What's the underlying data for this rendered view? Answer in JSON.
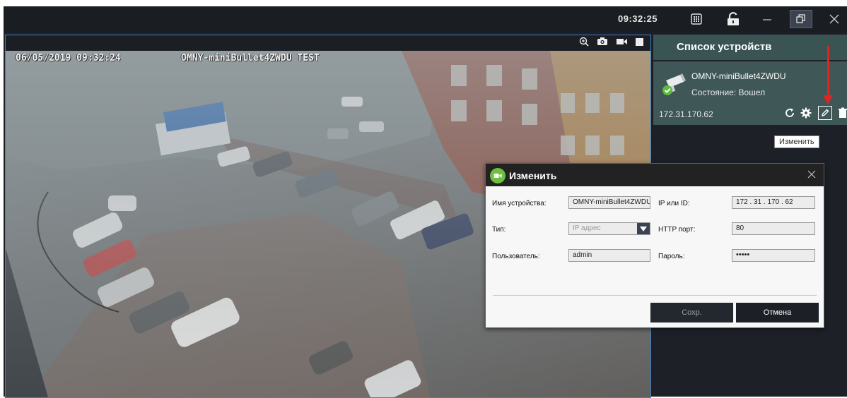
{
  "titlebar": {
    "time": "09:32:25",
    "icons": [
      "grid-icon",
      "lock-icon",
      "minimize-icon",
      "restore-icon",
      "close-icon"
    ]
  },
  "video": {
    "osd_datetime": "06/05/2019 09:32:24",
    "osd_camera_name": "OMNY-miniBullet4ZWDU TEST",
    "toolbar_icons": [
      "zoom-icon",
      "snapshot-icon",
      "record-icon",
      "stop-icon"
    ]
  },
  "sidebar": {
    "title": "Список устройств",
    "device": {
      "name": "OMNY-miniBullet4ZWDU",
      "status": "Состояние: Вошел",
      "ip": "172.31.170.62",
      "actions": [
        "refresh-icon",
        "settings-icon",
        "edit-icon",
        "delete-icon"
      ]
    },
    "tooltip": "Изменить"
  },
  "dialog": {
    "title": "Изменить",
    "fields": {
      "device_name_label": "Имя устройства:",
      "device_name_value": "OMNY-miniBullet4ZWDU",
      "ip_label": "IP или ID:",
      "ip_value": "172 . 31 . 170 . 62",
      "type_label": "Тип:",
      "type_value": "IP адрес",
      "http_port_label": "HTTP порт:",
      "http_port_value": "80",
      "user_label": "Пользователь:",
      "user_value": "admin",
      "password_label": "Пароль:",
      "password_value": "•••••"
    },
    "buttons": {
      "save": "Сохр.",
      "cancel": "Отмена"
    }
  },
  "colors": {
    "accent_blue": "#3d7fc2",
    "sidebar_header": "#3a5454",
    "device_card": "#3f5757",
    "dialog_icon_green": "#6cbf3f",
    "annotation_red": "#e02424"
  }
}
